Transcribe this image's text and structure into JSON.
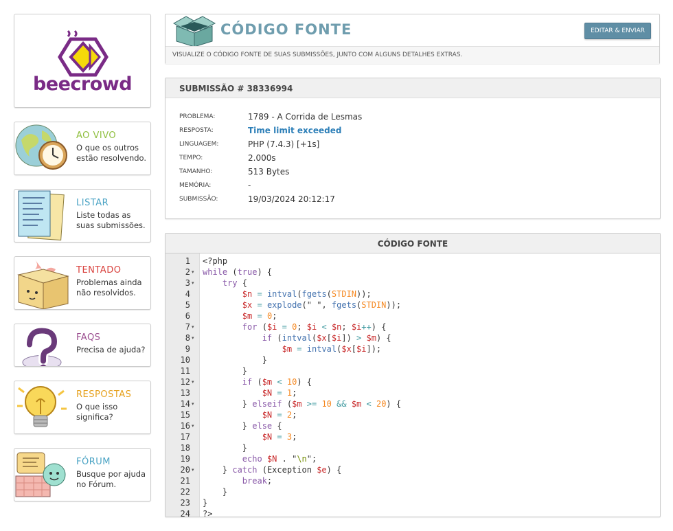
{
  "logo": {
    "text": "beecrowd"
  },
  "sidebar": [
    {
      "title": "AO VIVO",
      "desc": "O que os outros estão resolvendo.",
      "color": "#8fbf3f",
      "icon": "globe-clock-icon"
    },
    {
      "title": "LISTAR",
      "desc": "Liste todas as suas submissões.",
      "color": "#4aa3c4",
      "icon": "papers-icon"
    },
    {
      "title": "TENTADO",
      "desc": "Problemas ainda não resolvidos.",
      "color": "#d9413d",
      "icon": "box-icon"
    },
    {
      "title": "FAQS",
      "desc": "Precisa de ajuda?",
      "color": "#9b4e8f",
      "icon": "question-icon"
    },
    {
      "title": "RESPOSTAS",
      "desc": "O que isso significa?",
      "color": "#e6a01b",
      "icon": "lightbulb-icon"
    },
    {
      "title": "FÓRUM",
      "desc": "Busque por ajuda no Fórum.",
      "color": "#4aa3c4",
      "icon": "forum-icon"
    }
  ],
  "header": {
    "title": "CÓDIGO FONTE",
    "edit_button": "EDITAR & ENVIAR",
    "subtitle": "VISUALIZE O CÓDIGO FONTE DE SUAS SUBMISSÕES, JUNTO COM ALGUNS DETALHES EXTRAS."
  },
  "submission": {
    "title": "SUBMISSÃO # 38336994",
    "rows": [
      {
        "label": "PROBLEMA:",
        "value": "1789 - A Corrida de Lesmas"
      },
      {
        "label": "RESPOSTA:",
        "value": "Time limit exceeded"
      },
      {
        "label": "LINGUAGEM:",
        "value": "PHP (7.4.3) [+1s]"
      },
      {
        "label": "TEMPO:",
        "value": "2.000s"
      },
      {
        "label": "TAMANHO:",
        "value": "513 Bytes"
      },
      {
        "label": "MEMÓRIA:",
        "value": "-"
      },
      {
        "label": "SUBMISSÃO:",
        "value": "19/03/2024 20:12:17"
      }
    ]
  },
  "code": {
    "title": "CÓDIGO FONTE",
    "lines": [
      "<?php",
      "while (true) {",
      "    try {",
      "        $n = intval(fgets(STDIN));",
      "        $x = explode(\" \", fgets(STDIN));",
      "        $m = 0;",
      "        for ($i = 0; $i < $n; $i++) {",
      "            if (intval($x[$i]) > $m) {",
      "                $m = intval($x[$i]);",
      "            }",
      "        }",
      "        if ($m < 10) {",
      "            $N = 1;",
      "        } elseif ($m >= 10 && $m < 20) {",
      "            $N = 2;",
      "        } else {",
      "            $N = 3;",
      "        }",
      "        echo $N . \"\\n\";",
      "    } catch (Exception $e) {",
      "        break;",
      "    }",
      "}",
      "?>"
    ],
    "folds": [
      2,
      3,
      7,
      8,
      12,
      14,
      16,
      20
    ]
  }
}
